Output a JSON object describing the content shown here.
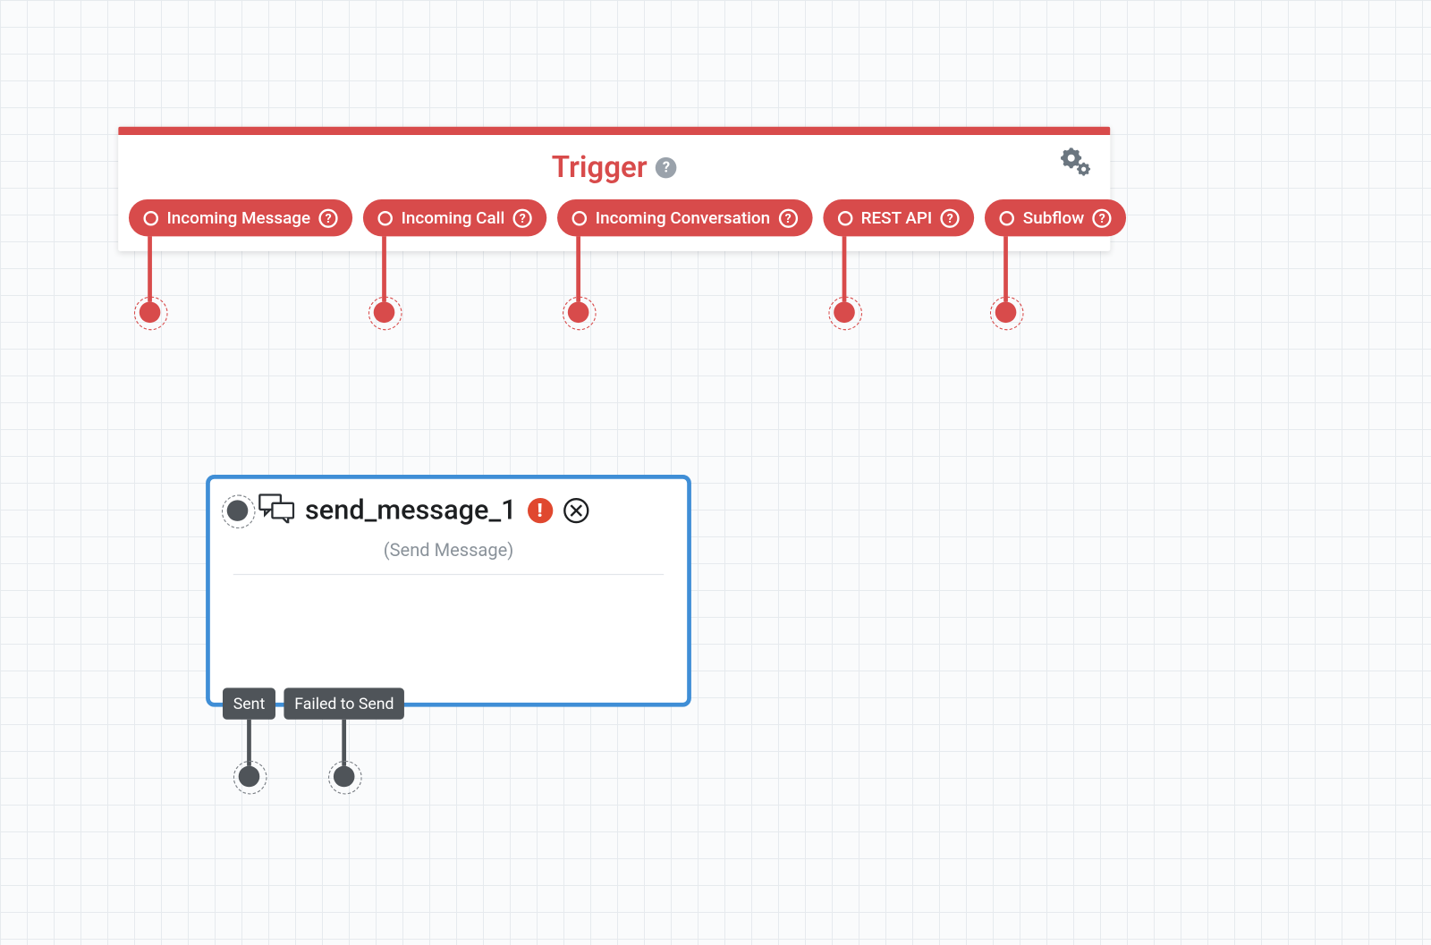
{
  "trigger": {
    "title": "Trigger",
    "pills": [
      {
        "label": "Incoming Message"
      },
      {
        "label": "Incoming Call"
      },
      {
        "label": "Incoming Conversation"
      },
      {
        "label": "REST API"
      },
      {
        "label": "Subflow"
      }
    ]
  },
  "node": {
    "title": "send_message_1",
    "subtitle": "(Send Message)",
    "outputs": [
      {
        "label": "Sent"
      },
      {
        "label": "Failed to Send"
      }
    ]
  },
  "colors": {
    "accent_red": "#d84b4b",
    "accent_blue": "#3f8ed6",
    "node_gray": "#4f5459"
  }
}
